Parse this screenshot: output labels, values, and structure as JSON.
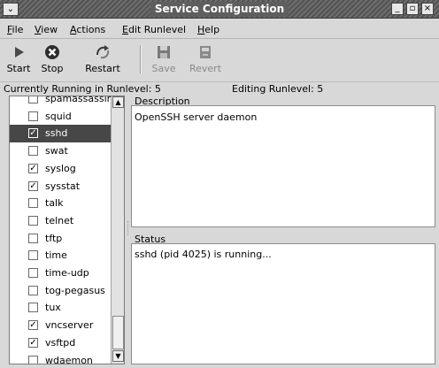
{
  "window": {
    "title": "Service Configuration",
    "sysmenu_glyph": "⌄",
    "buttons": [
      "_",
      "▫",
      "×"
    ]
  },
  "menu": {
    "file": {
      "key": "F",
      "rest": "ile"
    },
    "view": {
      "key": "V",
      "rest": "iew"
    },
    "actions": {
      "key": "A",
      "rest": "ctions"
    },
    "edit_runlevel": {
      "key": "E",
      "rest": "dit Runlevel"
    },
    "help": {
      "key": "H",
      "rest": "elp"
    }
  },
  "toolbar": {
    "start": {
      "label": "Start",
      "icon": "play-icon"
    },
    "stop": {
      "label": "Stop",
      "icon": "stop-icon"
    },
    "restart": {
      "label": "Restart",
      "icon": "restart-icon"
    },
    "save": {
      "label": "Save",
      "icon": "save-icon",
      "enabled": false
    },
    "revert": {
      "label": "Revert",
      "icon": "revert-icon",
      "enabled": false
    }
  },
  "runlevel": {
    "current": "Currently Running in Runlevel: 5",
    "editing": "Editing Runlevel: 5"
  },
  "services": [
    {
      "name": "spamassassin",
      "checked": false
    },
    {
      "name": "squid",
      "checked": false
    },
    {
      "name": "sshd",
      "checked": true,
      "selected": true
    },
    {
      "name": "swat",
      "checked": false
    },
    {
      "name": "syslog",
      "checked": true
    },
    {
      "name": "sysstat",
      "checked": true
    },
    {
      "name": "talk",
      "checked": false
    },
    {
      "name": "telnet",
      "checked": false
    },
    {
      "name": "tftp",
      "checked": false
    },
    {
      "name": "time",
      "checked": false
    },
    {
      "name": "time-udp",
      "checked": false
    },
    {
      "name": "tog-pegasus",
      "checked": false
    },
    {
      "name": "tux",
      "checked": false
    },
    {
      "name": "vncserver",
      "checked": true
    },
    {
      "name": "vsftpd",
      "checked": true
    },
    {
      "name": "wdaemon",
      "checked": false
    }
  ],
  "description": {
    "label": "Description",
    "text": "OpenSSH server daemon"
  },
  "status": {
    "label": "Status",
    "text": "sshd (pid 4025) is running..."
  },
  "colors": {
    "selection": "#474747",
    "titlebar": "#5e5e5e"
  }
}
